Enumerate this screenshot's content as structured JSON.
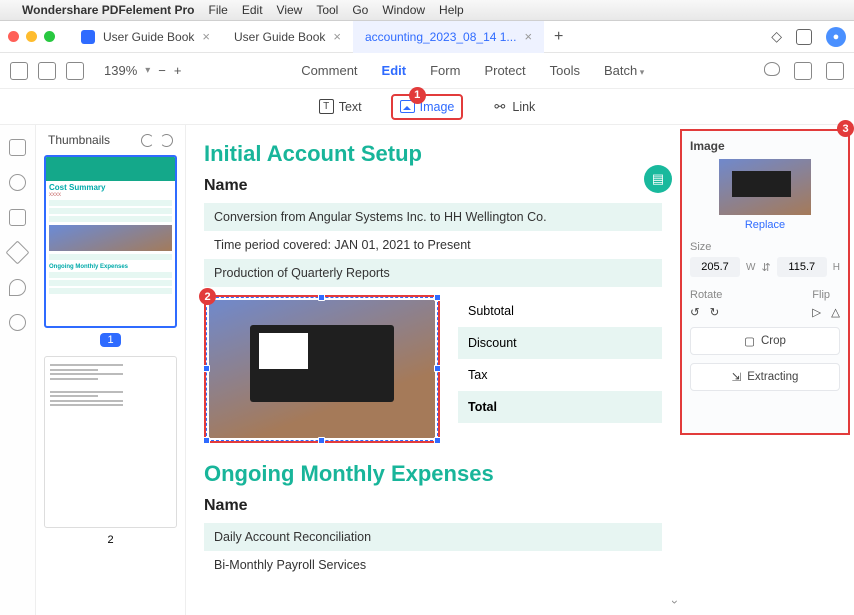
{
  "menubar": {
    "apple": "",
    "app": "Wondershare PDFelement Pro",
    "items": [
      "File",
      "Edit",
      "View",
      "Tool",
      "Go",
      "Window",
      "Help"
    ]
  },
  "tabs": [
    {
      "label": "User Guide Book",
      "active": false
    },
    {
      "label": "User Guide Book",
      "active": false
    },
    {
      "label": "accounting_2023_08_14 1...",
      "active": true
    }
  ],
  "zoom": {
    "value": "139%",
    "minus": "−",
    "plus": "+"
  },
  "main_tabs": {
    "comment": "Comment",
    "edit": "Edit",
    "form": "Form",
    "protect": "Protect",
    "tools": "Tools",
    "batch": "Batch"
  },
  "subtoolbar": {
    "text": "Text",
    "image": "Image",
    "link": "Link"
  },
  "thumbnails": {
    "title": "Thumbnails",
    "p1": "1",
    "p2": "2"
  },
  "doc": {
    "h1": "Initial Account Setup",
    "name_label": "Name",
    "rows": [
      "Conversion from Angular Systems Inc. to HH Wellington Co.",
      "Time period covered: JAN 01, 2021 to Present",
      "Production of Quarterly Reports"
    ],
    "summary": {
      "subtotal": "Subtotal",
      "discount": "Discount",
      "tax": "Tax",
      "total": "Total"
    },
    "h2": "Ongoing Monthly Expenses",
    "name_label2": "Name",
    "rows2": [
      "Daily Account Reconciliation",
      "Bi-Monthly Payroll Services"
    ]
  },
  "panel": {
    "title": "Image",
    "replace": "Replace",
    "size_label": "Size",
    "w": "205.7",
    "h": "115.7",
    "wl": "W",
    "hl": "H",
    "rotate": "Rotate",
    "flip": "Flip",
    "crop": "Crop",
    "extract": "Extracting"
  },
  "callouts": {
    "n1": "1",
    "n2": "2",
    "n3": "3"
  },
  "icons": {
    "rot_l": "↺",
    "rot_r": "↻",
    "flip_h": "▷",
    "flip_v": "△",
    "lock": "⇵",
    "crop": "▢",
    "extract": "⇲",
    "bell": "◇",
    "phone": "▭",
    "fab": "▤",
    "chev": "›"
  }
}
